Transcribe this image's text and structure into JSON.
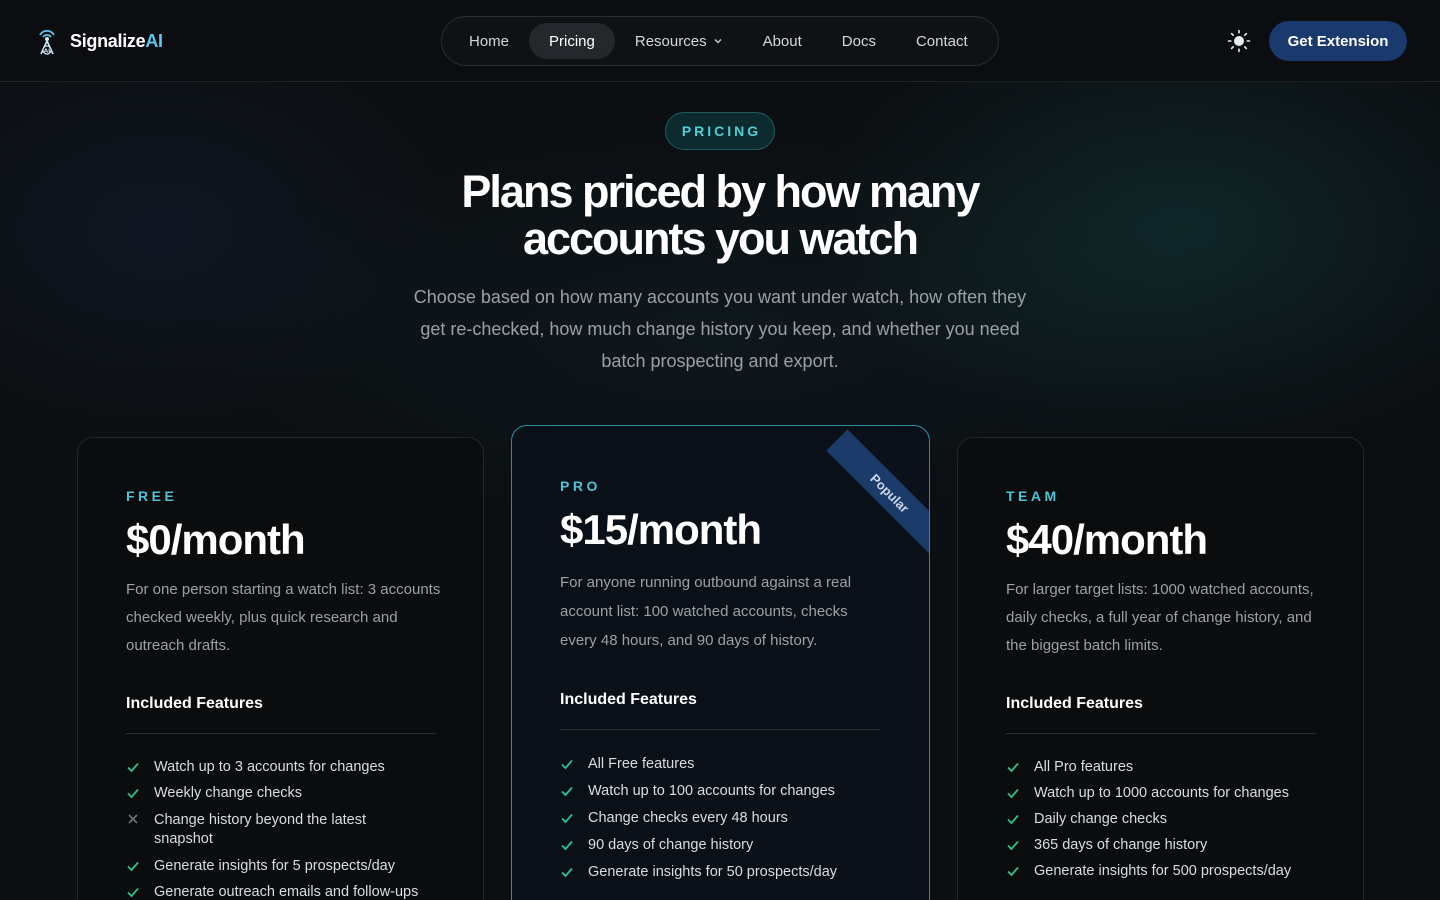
{
  "brand": {
    "name_main": "Signalize",
    "name_accent": "AI"
  },
  "nav": {
    "items": [
      {
        "label": "Home"
      },
      {
        "label": "Pricing"
      },
      {
        "label": "Resources"
      },
      {
        "label": "About"
      },
      {
        "label": "Docs"
      },
      {
        "label": "Contact"
      }
    ],
    "active": "Pricing"
  },
  "header": {
    "cta_label": "Get Extension",
    "theme_icon": "sun-icon"
  },
  "hero": {
    "eyebrow": "PRICING",
    "title": "Plans priced by how many accounts you watch",
    "subtitle": "Choose based on how many accounts you want under watch, how often they get re-checked, how much change history you keep, and whether you need batch prospecting and export."
  },
  "plans": [
    {
      "tier": "FREE",
      "price": "$0/month",
      "description": "For one person starting a watch list: 3 accounts checked weekly, plus quick research and outreach drafts.",
      "features_heading": "Included Features",
      "features": [
        {
          "text": "Watch up to 3 accounts for changes",
          "included": true
        },
        {
          "text": "Weekly change checks",
          "included": true
        },
        {
          "text": "Change history beyond the latest snapshot",
          "included": false
        },
        {
          "text": "Generate insights for 5 prospects/day",
          "included": true
        },
        {
          "text": "Generate outreach emails and follow-ups",
          "included": true
        }
      ]
    },
    {
      "tier": "PRO",
      "price": "$15/month",
      "badge": "Popular",
      "description": "For anyone running outbound against a real account list: 100 watched accounts, checks every 48 hours, and 90 days of history.",
      "features_heading": "Included Features",
      "features": [
        {
          "text": "All Free features",
          "included": true
        },
        {
          "text": "Watch up to 100 accounts for changes",
          "included": true
        },
        {
          "text": "Change checks every 48 hours",
          "included": true
        },
        {
          "text": "90 days of change history",
          "included": true
        },
        {
          "text": "Generate insights for 50 prospects/day",
          "included": true
        }
      ]
    },
    {
      "tier": "TEAM",
      "price": "$40/month",
      "description": "For larger target lists: 1000 watched accounts, daily checks, a full year of change history, and the biggest batch limits.",
      "features_heading": "Included Features",
      "features": [
        {
          "text": "All Pro features",
          "included": true
        },
        {
          "text": "Watch up to 1000 accounts for changes",
          "included": true
        },
        {
          "text": "Daily change checks",
          "included": true
        },
        {
          "text": "365 days of change history",
          "included": true
        },
        {
          "text": "Generate insights for 500 prospects/day",
          "included": true
        }
      ]
    }
  ],
  "colors": {
    "accent": "#4fc3d6",
    "cta": "#1a3a6e",
    "check": "#2fbf8f",
    "cross": "#6b7178"
  }
}
